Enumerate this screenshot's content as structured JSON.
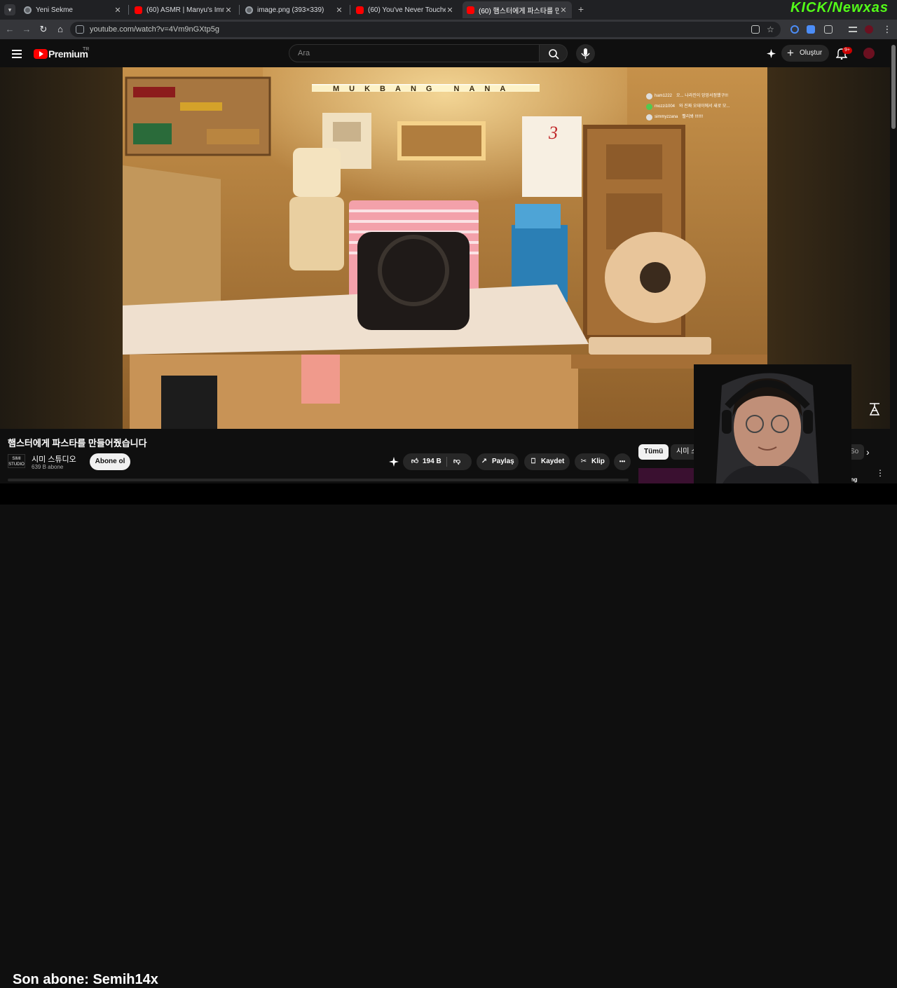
{
  "browser": {
    "tabs": [
      {
        "label": "Yeni Sekme",
        "icon": "chrome-icon",
        "active": false
      },
      {
        "label": "(60) ASMR | Manyu's Immersive",
        "icon": "youtube-icon",
        "active": false
      },
      {
        "label": "image.png (393×339)",
        "icon": "globe-icon",
        "active": false
      },
      {
        "label": "(60) You've Never Touched Any",
        "icon": "youtube-icon",
        "active": false
      },
      {
        "label": "(60) 햄스터에게 파스타를 만들",
        "icon": "youtube-icon",
        "active": true
      }
    ],
    "url": "youtube.com/watch?v=4Vm9nGXtp5g"
  },
  "overlay": {
    "kick_brand": "KICK/Newxas",
    "ticker": "Son abone: Semih14x"
  },
  "youtube": {
    "brand": "Premium",
    "region": "TR",
    "search_placeholder": "Ara",
    "create_label": "Oluştur",
    "notifications_badge": "9+"
  },
  "video": {
    "title": "햄스터에게 파스타를 만들어줬습니다",
    "banner_text": "MUKBANG NANA",
    "calendar_number": "3",
    "chat": [
      {
        "user": "ham1222",
        "message": "오... 나라진이 앙앙서정했구!!!"
      },
      {
        "user": "mozzi1004",
        "message": "와 진짜 오데이에서 새로 모..."
      },
      {
        "user": "simmyzzana",
        "message": "빨리봐 !!!!!!!"
      }
    ]
  },
  "channel": {
    "logo_text": "SIMI STUDIO",
    "name": "시미 스튜디오",
    "subscribers": "639 B abone",
    "subscribe_label": "Abone ol"
  },
  "actions": {
    "likes": "194 B",
    "share": "Paylaş",
    "save": "Kaydet",
    "clip": "Klip",
    "more": "•••"
  },
  "recommendations": {
    "chips": [
      "Tümü",
      "시미 스...",
      "So"
    ],
    "partial_title": "Amazing"
  },
  "colors": {
    "yt_red": "#ff0000",
    "kick_green": "#53fc18",
    "background": "#0f0f0f"
  }
}
